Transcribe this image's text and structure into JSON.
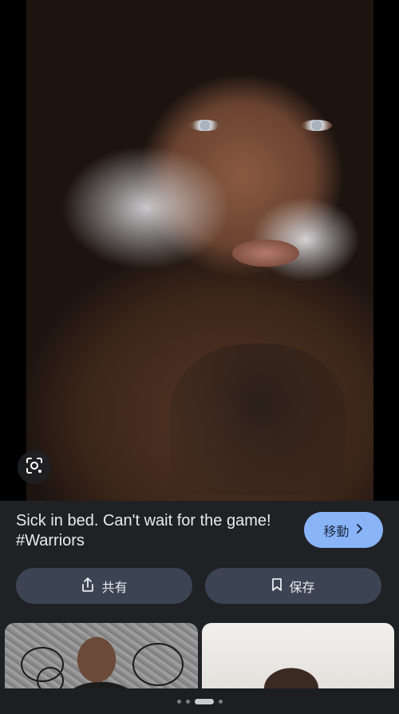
{
  "post": {
    "caption": "Sick in bed. Can't wait for the game! #Warriors"
  },
  "actions": {
    "visit_label": "移動",
    "share_label": "共有",
    "save_label": "保存"
  },
  "icons": {
    "lens": "lens-search-icon",
    "chevron": "chevron-right-icon",
    "share": "share-icon",
    "bookmark": "bookmark-icon"
  },
  "colors": {
    "panel_background": "#202124",
    "visit_button": "#8ab4f8",
    "secondary_button": "#3c4454",
    "text_primary": "#e8eaed"
  },
  "carousel": {
    "total": 4,
    "active_index": 2
  }
}
